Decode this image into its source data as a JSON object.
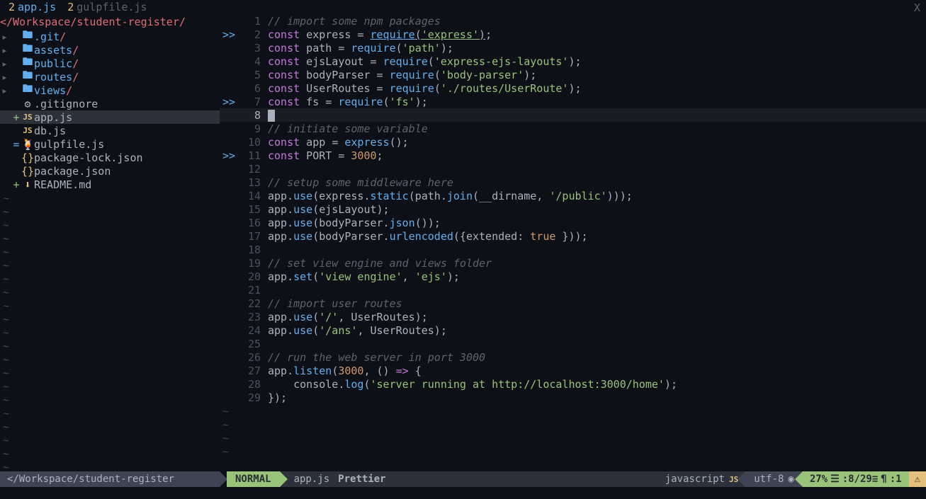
{
  "tabs": [
    {
      "num": "2",
      "name": "app.js",
      "active": true
    },
    {
      "num": "2",
      "name": "gulpfile.js",
      "active": false
    }
  ],
  "close_x": "X",
  "sidebar": {
    "header": "</Workspace/student-register/",
    "items": [
      {
        "arrow": "▸",
        "diff": "",
        "icon": "folder",
        "name": ".git",
        "slash": "/"
      },
      {
        "arrow": "▸",
        "diff": "",
        "icon": "folder",
        "name": "assets",
        "slash": "/"
      },
      {
        "arrow": "▸",
        "diff": "",
        "icon": "folder",
        "name": "public",
        "slash": "/"
      },
      {
        "arrow": "▸",
        "diff": "",
        "icon": "folder",
        "name": "routes",
        "slash": "/"
      },
      {
        "arrow": "▸",
        "diff": "",
        "icon": "folder",
        "name": "views",
        "slash": "/"
      },
      {
        "arrow": "",
        "diff": "",
        "icon": "gear",
        "name": ".gitignore",
        "slash": ""
      },
      {
        "arrow": "",
        "diff": "+",
        "icon": "js",
        "name": "app.js",
        "slash": "",
        "selected": true
      },
      {
        "arrow": "",
        "diff": "",
        "icon": "js",
        "name": "db.js",
        "slash": ""
      },
      {
        "arrow": "",
        "diff": "=",
        "icon": "gulp",
        "name": "gulpfile.js",
        "slash": ""
      },
      {
        "arrow": "",
        "diff": "",
        "icon": "json",
        "name": "package-lock.json",
        "slash": ""
      },
      {
        "arrow": "",
        "diff": "",
        "icon": "json",
        "name": "package.json",
        "slash": ""
      },
      {
        "arrow": "",
        "diff": "+",
        "icon": "md",
        "name": "README.md",
        "slash": ""
      }
    ]
  },
  "code": {
    "lines": [
      {
        "n": 1,
        "sign": "",
        "tokens": [
          {
            "c": "c-comment",
            "t": "// import some npm packages"
          }
        ]
      },
      {
        "n": 2,
        "sign": ">>",
        "tokens": [
          {
            "c": "c-keyword",
            "t": "const"
          },
          {
            "c": "",
            "t": " express "
          },
          {
            "c": "c-op",
            "t": "="
          },
          {
            "c": "",
            "t": " "
          },
          {
            "c": "c-func c-underline",
            "t": "require"
          },
          {
            "c": "c-underline",
            "t": "("
          },
          {
            "c": "c-string c-underline",
            "t": "'express'"
          },
          {
            "c": "c-underline",
            "t": ")"
          },
          {
            "c": "",
            "t": ";"
          }
        ]
      },
      {
        "n": 3,
        "sign": "",
        "tokens": [
          {
            "c": "c-keyword",
            "t": "const"
          },
          {
            "c": "",
            "t": " path "
          },
          {
            "c": "c-op",
            "t": "="
          },
          {
            "c": "",
            "t": " "
          },
          {
            "c": "c-func",
            "t": "require"
          },
          {
            "c": "",
            "t": "("
          },
          {
            "c": "c-string",
            "t": "'path'"
          },
          {
            "c": "",
            "t": ");"
          }
        ]
      },
      {
        "n": 4,
        "sign": "",
        "tokens": [
          {
            "c": "c-keyword",
            "t": "const"
          },
          {
            "c": "",
            "t": " ejsLayout "
          },
          {
            "c": "c-op",
            "t": "="
          },
          {
            "c": "",
            "t": " "
          },
          {
            "c": "c-func",
            "t": "require"
          },
          {
            "c": "",
            "t": "("
          },
          {
            "c": "c-string",
            "t": "'express-ejs-layouts'"
          },
          {
            "c": "",
            "t": ");"
          }
        ]
      },
      {
        "n": 5,
        "sign": "",
        "tokens": [
          {
            "c": "c-keyword",
            "t": "const"
          },
          {
            "c": "",
            "t": " bodyParser "
          },
          {
            "c": "c-op",
            "t": "="
          },
          {
            "c": "",
            "t": " "
          },
          {
            "c": "c-func",
            "t": "require"
          },
          {
            "c": "",
            "t": "("
          },
          {
            "c": "c-string",
            "t": "'body-parser'"
          },
          {
            "c": "",
            "t": ");"
          }
        ]
      },
      {
        "n": 6,
        "sign": "",
        "tokens": [
          {
            "c": "c-keyword",
            "t": "const"
          },
          {
            "c": "",
            "t": " UserRoutes "
          },
          {
            "c": "c-op",
            "t": "="
          },
          {
            "c": "",
            "t": " "
          },
          {
            "c": "c-func",
            "t": "require"
          },
          {
            "c": "",
            "t": "("
          },
          {
            "c": "c-string",
            "t": "'./routes/UserRoute'"
          },
          {
            "c": "",
            "t": ");"
          }
        ]
      },
      {
        "n": 7,
        "sign": ">>",
        "tokens": [
          {
            "c": "c-keyword",
            "t": "const"
          },
          {
            "c": "",
            "t": " fs "
          },
          {
            "c": "c-op",
            "t": "="
          },
          {
            "c": "",
            "t": " "
          },
          {
            "c": "c-func",
            "t": "require"
          },
          {
            "c": "",
            "t": "("
          },
          {
            "c": "c-string",
            "t": "'fs'"
          },
          {
            "c": "",
            "t": ");"
          }
        ]
      },
      {
        "n": 8,
        "sign": "",
        "cursor": true,
        "tokens": []
      },
      {
        "n": 9,
        "sign": "",
        "tokens": [
          {
            "c": "c-comment",
            "t": "// initiate some variable"
          }
        ]
      },
      {
        "n": 10,
        "sign": "",
        "tokens": [
          {
            "c": "c-keyword",
            "t": "const"
          },
          {
            "c": "",
            "t": " app "
          },
          {
            "c": "c-op",
            "t": "="
          },
          {
            "c": "",
            "t": " "
          },
          {
            "c": "c-func",
            "t": "express"
          },
          {
            "c": "",
            "t": "();"
          }
        ]
      },
      {
        "n": 11,
        "sign": ">>",
        "tokens": [
          {
            "c": "c-keyword",
            "t": "const"
          },
          {
            "c": "",
            "t": " PORT "
          },
          {
            "c": "c-op",
            "t": "="
          },
          {
            "c": "",
            "t": " "
          },
          {
            "c": "c-num",
            "t": "3000"
          },
          {
            "c": "",
            "t": ";"
          }
        ]
      },
      {
        "n": 12,
        "sign": "",
        "tokens": []
      },
      {
        "n": 13,
        "sign": "",
        "tokens": [
          {
            "c": "c-comment",
            "t": "// setup some middleware here"
          }
        ]
      },
      {
        "n": 14,
        "sign": "",
        "tokens": [
          {
            "c": "",
            "t": "app."
          },
          {
            "c": "c-func",
            "t": "use"
          },
          {
            "c": "",
            "t": "(express."
          },
          {
            "c": "c-func",
            "t": "static"
          },
          {
            "c": "",
            "t": "(path."
          },
          {
            "c": "c-func",
            "t": "join"
          },
          {
            "c": "",
            "t": "(__dirname, "
          },
          {
            "c": "c-string",
            "t": "'/public'"
          },
          {
            "c": "",
            "t": ")));"
          }
        ]
      },
      {
        "n": 15,
        "sign": "",
        "tokens": [
          {
            "c": "",
            "t": "app."
          },
          {
            "c": "c-func",
            "t": "use"
          },
          {
            "c": "",
            "t": "(ejsLayout);"
          }
        ]
      },
      {
        "n": 16,
        "sign": "",
        "tokens": [
          {
            "c": "",
            "t": "app."
          },
          {
            "c": "c-func",
            "t": "use"
          },
          {
            "c": "",
            "t": "(bodyParser."
          },
          {
            "c": "c-func",
            "t": "json"
          },
          {
            "c": "",
            "t": "());"
          }
        ]
      },
      {
        "n": 17,
        "sign": "",
        "tokens": [
          {
            "c": "",
            "t": "app."
          },
          {
            "c": "c-func",
            "t": "use"
          },
          {
            "c": "",
            "t": "(bodyParser."
          },
          {
            "c": "c-func",
            "t": "urlencoded"
          },
          {
            "c": "",
            "t": "({extended: "
          },
          {
            "c": "c-num",
            "t": "true"
          },
          {
            "c": "",
            "t": " }));"
          }
        ]
      },
      {
        "n": 18,
        "sign": "",
        "tokens": []
      },
      {
        "n": 19,
        "sign": "",
        "tokens": [
          {
            "c": "c-comment",
            "t": "// set view engine and views folder"
          }
        ]
      },
      {
        "n": 20,
        "sign": "",
        "tokens": [
          {
            "c": "",
            "t": "app."
          },
          {
            "c": "c-func",
            "t": "set"
          },
          {
            "c": "",
            "t": "("
          },
          {
            "c": "c-string",
            "t": "'view engine'"
          },
          {
            "c": "",
            "t": ", "
          },
          {
            "c": "c-string",
            "t": "'ejs'"
          },
          {
            "c": "",
            "t": ");"
          }
        ]
      },
      {
        "n": 21,
        "sign": "",
        "tokens": []
      },
      {
        "n": 22,
        "sign": "",
        "tokens": [
          {
            "c": "c-comment",
            "t": "// import user routes"
          }
        ]
      },
      {
        "n": 23,
        "sign": "",
        "tokens": [
          {
            "c": "",
            "t": "app."
          },
          {
            "c": "c-func",
            "t": "use"
          },
          {
            "c": "",
            "t": "("
          },
          {
            "c": "c-string",
            "t": "'/'"
          },
          {
            "c": "",
            "t": ", UserRoutes);"
          }
        ]
      },
      {
        "n": 24,
        "sign": "",
        "tokens": [
          {
            "c": "",
            "t": "app."
          },
          {
            "c": "c-func",
            "t": "use"
          },
          {
            "c": "",
            "t": "("
          },
          {
            "c": "c-string",
            "t": "'/ans'"
          },
          {
            "c": "",
            "t": ", UserRoutes);"
          }
        ]
      },
      {
        "n": 25,
        "sign": "",
        "tokens": []
      },
      {
        "n": 26,
        "sign": "",
        "tokens": [
          {
            "c": "c-comment",
            "t": "// run the web server in port 3000"
          }
        ]
      },
      {
        "n": 27,
        "sign": "",
        "tokens": [
          {
            "c": "",
            "t": "app."
          },
          {
            "c": "c-func",
            "t": "listen"
          },
          {
            "c": "",
            "t": "("
          },
          {
            "c": "c-num",
            "t": "3000"
          },
          {
            "c": "",
            "t": ", () "
          },
          {
            "c": "c-keyword",
            "t": "=>"
          },
          {
            "c": "",
            "t": " {"
          }
        ]
      },
      {
        "n": 28,
        "sign": "",
        "tokens": [
          {
            "c": "",
            "t": "    console."
          },
          {
            "c": "c-func",
            "t": "log"
          },
          {
            "c": "",
            "t": "("
          },
          {
            "c": "c-string",
            "t": "'server running at http://localhost:3000/home'"
          },
          {
            "c": "",
            "t": ");"
          }
        ]
      },
      {
        "n": 29,
        "sign": "",
        "tokens": [
          {
            "c": "",
            "t": "});"
          }
        ]
      }
    ],
    "current_line": 8,
    "tildes": 4
  },
  "statusline": {
    "left_path": "</Workspace/student-register",
    "mode": "NORMAL",
    "file": "app.js",
    "formatter": "Prettier",
    "lang": "javascript",
    "lang_badge": "JS",
    "encoding": "utf-8",
    "enc_icon": "◉",
    "percent": "27%",
    "line_info": ":8/29≡",
    "col_info": ":1",
    "line_icon": "☰",
    "col_icon": "¶"
  }
}
